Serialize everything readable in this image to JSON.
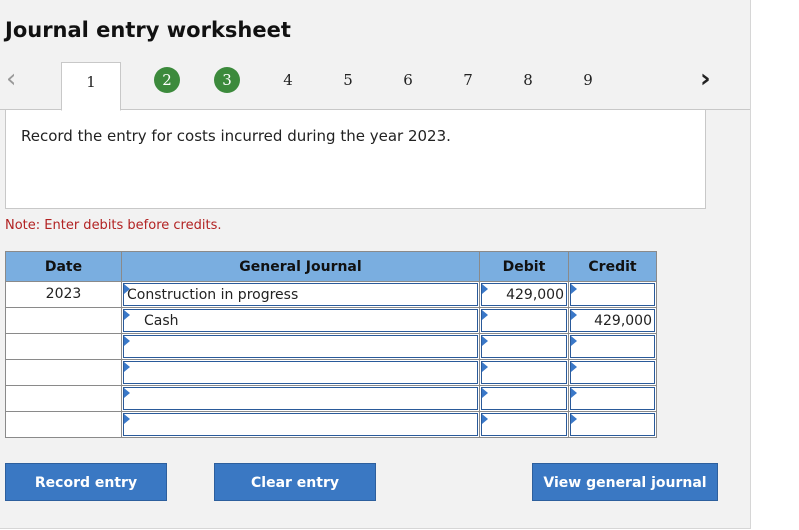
{
  "title": "Journal entry worksheet",
  "pager": {
    "prev_icon": "chevron-left-icon",
    "next_icon": "chevron-right-icon",
    "prev_glyph": "‹",
    "next_glyph": "›",
    "tabs": [
      {
        "label": "1",
        "state": "active"
      },
      {
        "label": "2",
        "state": "done"
      },
      {
        "label": "3",
        "state": "done"
      },
      {
        "label": "4",
        "state": "todo"
      },
      {
        "label": "5",
        "state": "todo"
      },
      {
        "label": "6",
        "state": "todo"
      },
      {
        "label": "7",
        "state": "todo"
      },
      {
        "label": "8",
        "state": "todo"
      },
      {
        "label": "9",
        "state": "todo"
      }
    ]
  },
  "instruction": "Record the entry for costs incurred during the year 2023.",
  "note": "Note: Enter debits before credits.",
  "table": {
    "headers": {
      "date": "Date",
      "journal": "General Journal",
      "debit": "Debit",
      "credit": "Credit"
    },
    "rows": [
      {
        "date": "2023",
        "account": "Construction in progress",
        "debit": "429,000",
        "credit": ""
      },
      {
        "date": "",
        "account": "Cash",
        "debit": "",
        "credit": "429,000"
      },
      {
        "date": "",
        "account": "",
        "debit": "",
        "credit": ""
      },
      {
        "date": "",
        "account": "",
        "debit": "",
        "credit": ""
      },
      {
        "date": "",
        "account": "",
        "debit": "",
        "credit": ""
      },
      {
        "date": "",
        "account": "",
        "debit": "",
        "credit": ""
      }
    ]
  },
  "buttons": {
    "record": "Record entry",
    "clear": "Clear entry",
    "view": "View general journal"
  },
  "colors": {
    "accent": "#3a78c3",
    "header": "#7aaee0",
    "done_step": "#3c8a3c",
    "note": "#b22222"
  }
}
